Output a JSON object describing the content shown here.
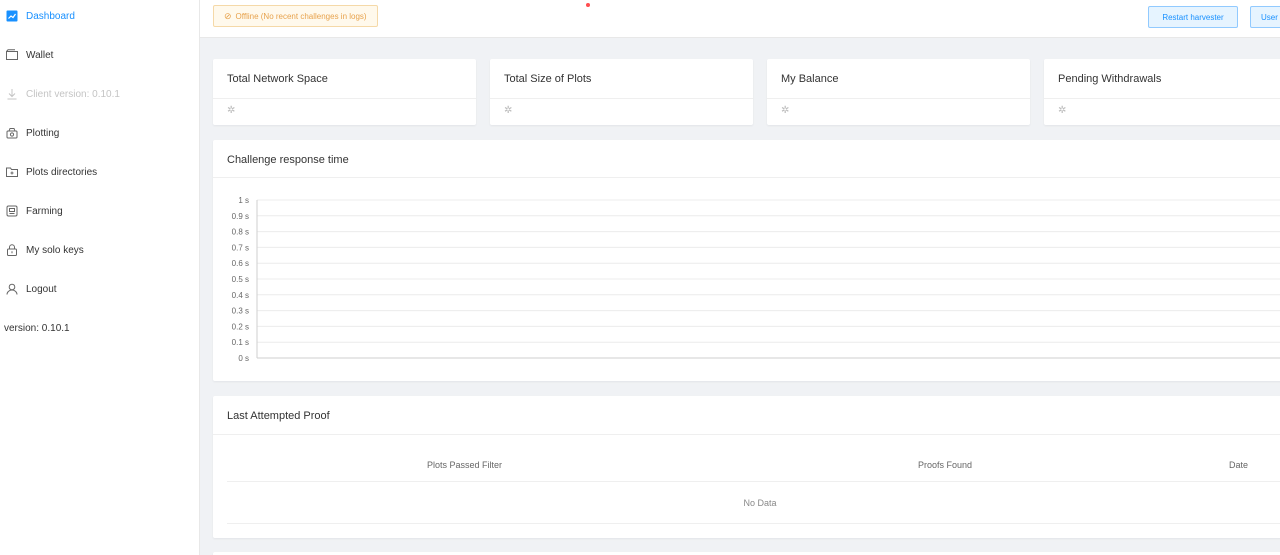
{
  "sidebar": {
    "items": [
      {
        "label": "Dashboard",
        "icon": "dashboard-icon"
      },
      {
        "label": "Wallet",
        "icon": "wallet-icon"
      },
      {
        "label": "Client version: 0.10.1",
        "icon": "download-icon"
      },
      {
        "label": "Plotting",
        "icon": "plotting-icon"
      },
      {
        "label": "Plots directories",
        "icon": "folder-icon"
      },
      {
        "label": "Farming",
        "icon": "farming-icon"
      },
      {
        "label": "My solo keys",
        "icon": "lock-icon"
      },
      {
        "label": "Logout",
        "icon": "user-icon"
      }
    ],
    "version": "version: 0.10.1"
  },
  "header": {
    "status": "Offline (No recent challenges in logs)",
    "restart_label": "Restart harvester",
    "user_label": "User"
  },
  "stats": [
    {
      "title": "Total Network Space"
    },
    {
      "title": "Total Size of Plots"
    },
    {
      "title": "My Balance"
    },
    {
      "title": "Pending Withdrawals"
    }
  ],
  "chart": {
    "title": "Challenge response time"
  },
  "chart_data": {
    "type": "line",
    "title": "Challenge response time",
    "xlabel": "",
    "ylabel": "",
    "ylim": [
      0,
      1
    ],
    "y_ticks": [
      "0 s",
      "0.1 s",
      "0.2 s",
      "0.3 s",
      "0.4 s",
      "0.5 s",
      "0.6 s",
      "0.7 s",
      "0.8 s",
      "0.9 s",
      "1 s"
    ],
    "grid": true,
    "series": []
  },
  "proof": {
    "title": "Last Attempted Proof",
    "columns": [
      "Plots Passed Filter",
      "Proofs Found",
      "Date"
    ],
    "empty": "No Data"
  }
}
